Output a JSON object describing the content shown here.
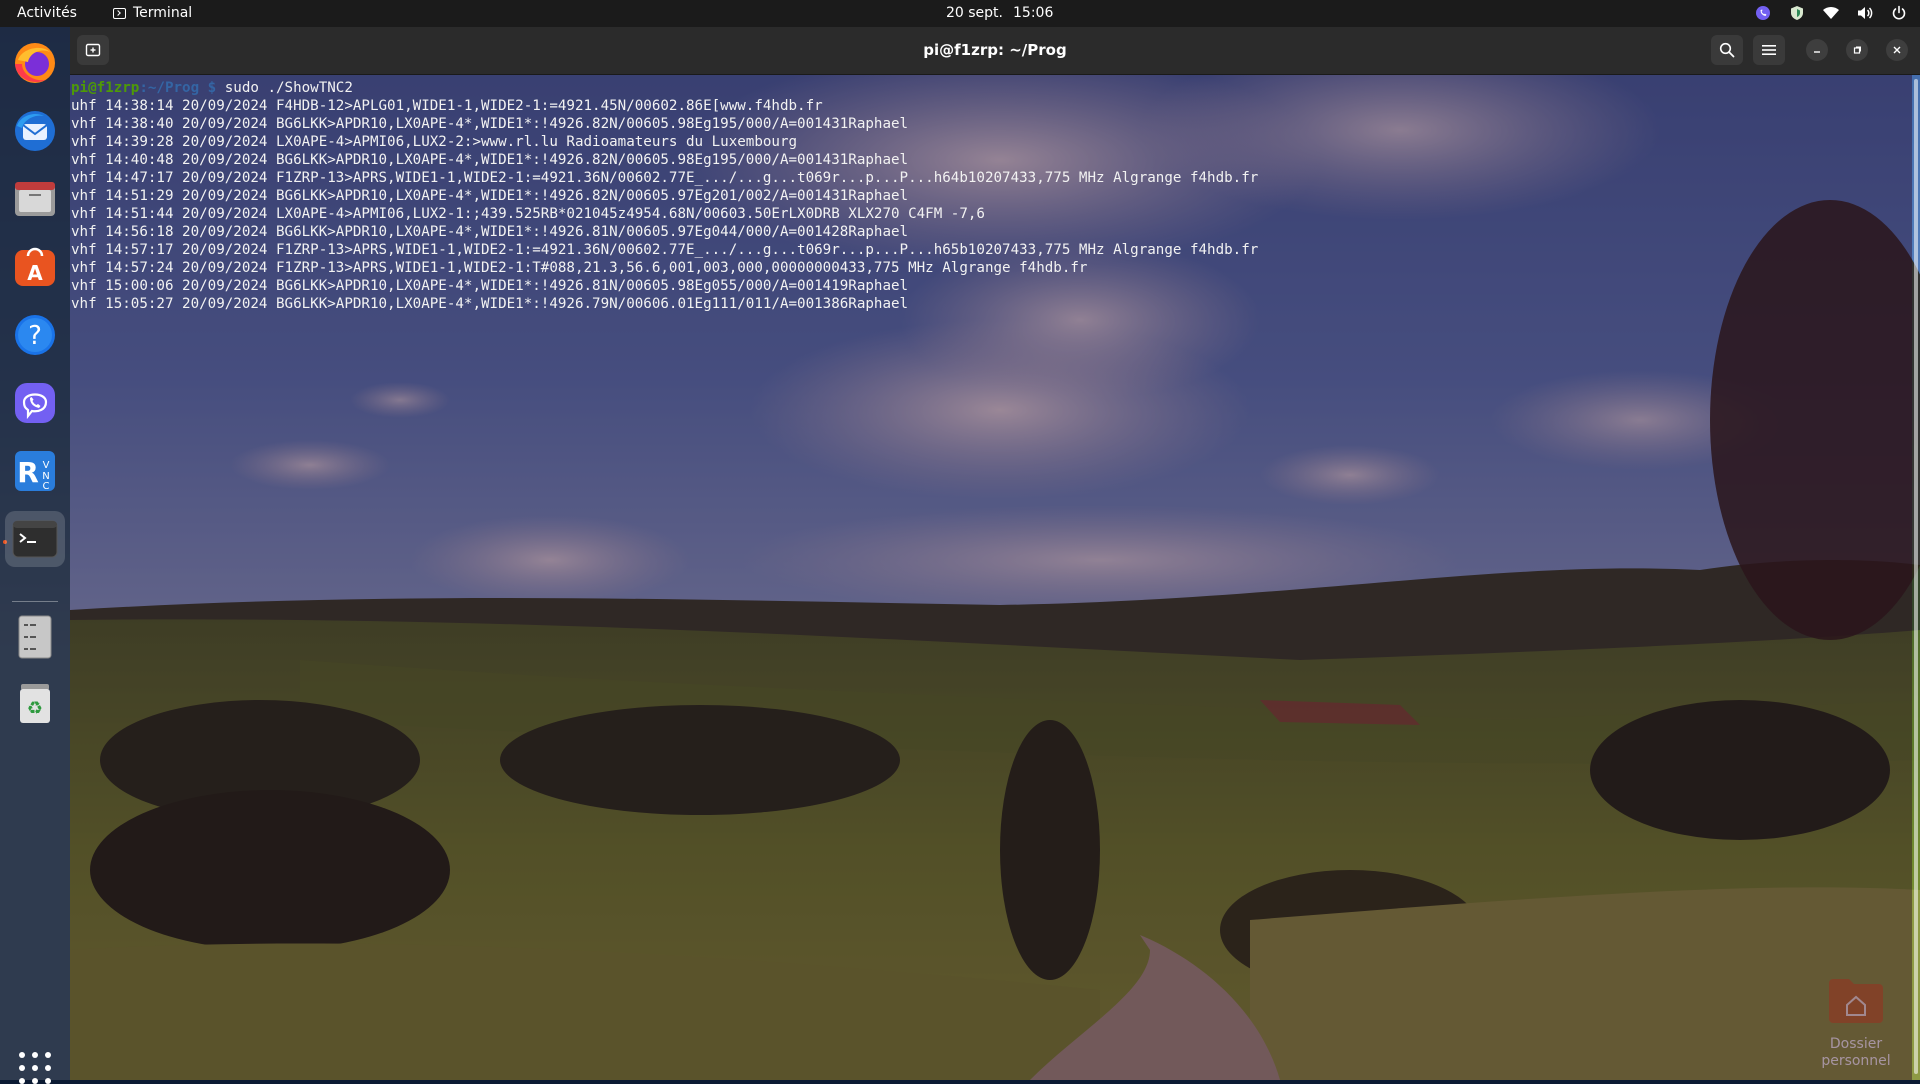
{
  "topbar": {
    "activities": "Activités",
    "app_name": "Terminal",
    "date": "20 sept.",
    "time": "15:06"
  },
  "dock": {
    "items": [
      {
        "name": "firefox",
        "icon": "firefox-icon"
      },
      {
        "name": "thunderbird",
        "icon": "thunderbird-icon"
      },
      {
        "name": "files",
        "icon": "files-icon"
      },
      {
        "name": "app-center",
        "icon": "app-center-icon"
      },
      {
        "name": "help",
        "icon": "help-icon"
      },
      {
        "name": "viber",
        "icon": "viber-icon"
      },
      {
        "name": "realvnc",
        "icon": "realvnc-icon"
      },
      {
        "name": "terminal",
        "icon": "terminal-icon",
        "running": true
      },
      {
        "name": "drive",
        "icon": "drive-icon"
      },
      {
        "name": "trash",
        "icon": "trash-icon"
      }
    ],
    "show_apps_icon": "app-grid-icon"
  },
  "terminal": {
    "title": "pi@f1zrp: ~/Prog",
    "prompt_user": "pi@f1zrp",
    "prompt_path": ":~/Prog $",
    "command": " sudo ./ShowTNC2",
    "lines": [
      "uhf 14:38:14 20/09/2024 F4HDB-12>APLG01,WIDE1-1,WIDE2-1:=4921.45N/00602.86E[www.f4hdb.fr",
      "vhf 14:38:40 20/09/2024 BG6LKK>APDR10,LX0APE-4*,WIDE1*:!4926.82N/00605.98Eg195/000/A=001431Raphael",
      "vhf 14:39:28 20/09/2024 LX0APE-4>APMI06,LUX2-2:>www.rl.lu Radioamateurs du Luxembourg",
      "vhf 14:40:48 20/09/2024 BG6LKK>APDR10,LX0APE-4*,WIDE1*:!4926.82N/00605.98Eg195/000/A=001431Raphael",
      "vhf 14:47:17 20/09/2024 F1ZRP-13>APRS,WIDE1-1,WIDE2-1:=4921.36N/00602.77E_.../...g...t069r...p...P...h64b10207433,775 MHz Algrange f4hdb.fr",
      "vhf 14:51:29 20/09/2024 BG6LKK>APDR10,LX0APE-4*,WIDE1*:!4926.82N/00605.97Eg201/002/A=001431Raphael",
      "vhf 14:51:44 20/09/2024 LX0APE-4>APMI06,LUX2-1:;439.525RB*021045z4954.68N/00603.50ErLX0DRB XLX270 C4FM -7,6",
      "vhf 14:56:18 20/09/2024 BG6LKK>APDR10,LX0APE-4*,WIDE1*:!4926.81N/00605.97Eg044/000/A=001428Raphael",
      "vhf 14:57:17 20/09/2024 F1ZRP-13>APRS,WIDE1-1,WIDE2-1:=4921.36N/00602.77E_.../...g...t069r...p...P...h65b10207433,775 MHz Algrange f4hdb.fr",
      "vhf 14:57:24 20/09/2024 F1ZRP-13>APRS,WIDE1-1,WIDE2-1:T#088,21.3,56.6,001,003,000,00000000433,775 MHz Algrange f4hdb.fr",
      "vhf 15:00:06 20/09/2024 BG6LKK>APDR10,LX0APE-4*,WIDE1*:!4926.81N/00605.98Eg055/000/A=001419Raphael",
      "vhf 15:05:27 20/09/2024 BG6LKK>APDR10,LX0APE-4*,WIDE1*:!4926.79N/00606.01Eg111/011/A=001386Raphael"
    ]
  },
  "desktop": {
    "home_folder_line1": "Dossier",
    "home_folder_line2": "personnel"
  },
  "colors": {
    "topbar_bg": "#1b1b1b",
    "terminal_header_bg": "#2b2b2b",
    "prompt_user": "#4e9a06",
    "prompt_path": "#3465a4",
    "ubuntu_orange": "#e95420"
  }
}
